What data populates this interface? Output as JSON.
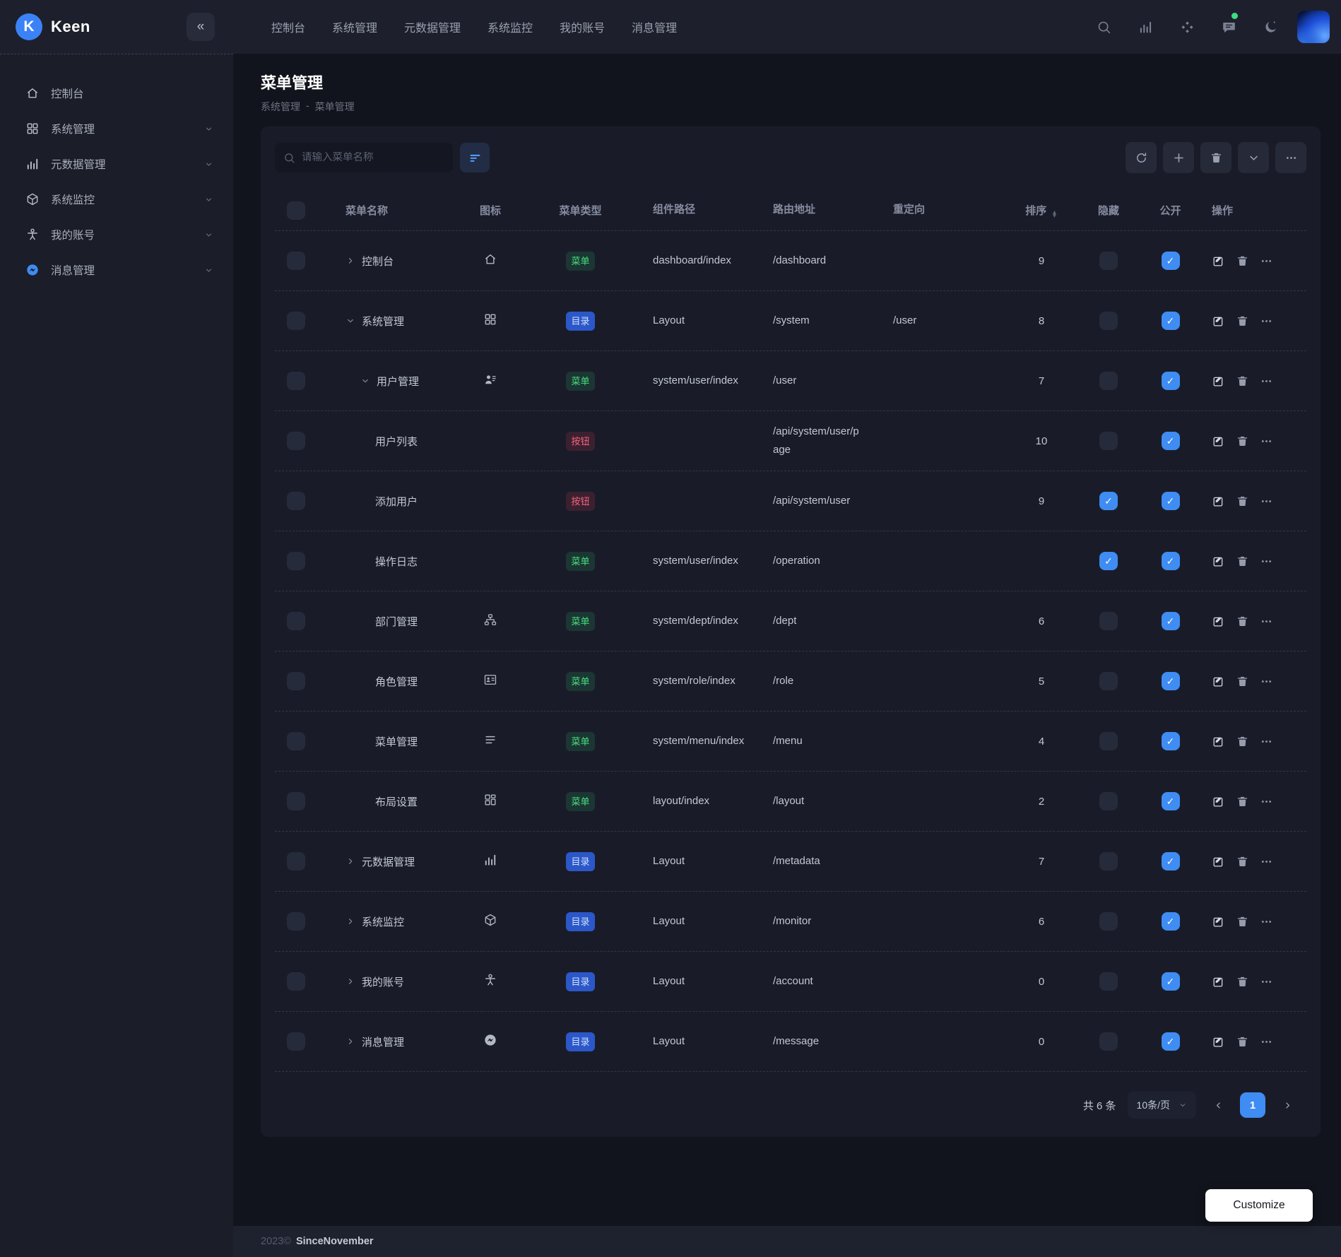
{
  "brand": {
    "name": "Keen"
  },
  "navbar": {
    "collapse_icon": "«",
    "items": [
      "控制台",
      "系统管理",
      "元数据管理",
      "系统监控",
      "我的账号",
      "消息管理"
    ],
    "action_icons": [
      "search",
      "chart",
      "apps",
      "chat",
      "moon"
    ],
    "chat_has_badge": true
  },
  "sidebar": {
    "items": [
      {
        "label": "控制台",
        "icon": "home",
        "expandable": false
      },
      {
        "label": "系统管理",
        "icon": "grid",
        "expandable": true
      },
      {
        "label": "元数据管理",
        "icon": "chart",
        "expandable": true
      },
      {
        "label": "系统监控",
        "icon": "cube",
        "expandable": true
      },
      {
        "label": "我的账号",
        "icon": "person",
        "expandable": true
      },
      {
        "label": "消息管理",
        "icon": "messenger",
        "expandable": true
      }
    ]
  },
  "page": {
    "title": "菜单管理",
    "breadcrumb": {
      "parent": "系统管理",
      "separator": "-",
      "current": "菜单管理"
    }
  },
  "toolbar": {
    "search_placeholder": "请输入菜单名称",
    "action_icons": [
      "refresh",
      "plus",
      "trash",
      "chevron-down",
      "more"
    ]
  },
  "table": {
    "headers": {
      "name": "菜单名称",
      "icon": "图标",
      "type": "菜单类型",
      "component": "组件路径",
      "route": "路由地址",
      "redirect": "重定向",
      "sort": "排序",
      "hidden": "隐藏",
      "public": "公开",
      "ops": "操作"
    },
    "rows": [
      {
        "name": "控制台",
        "level": 0,
        "expand": "closed",
        "icon": "home",
        "type": "menu",
        "type_label": "菜单",
        "component": "dashboard/index",
        "route": "/dashboard",
        "redirect": "",
        "sort": "9",
        "hidden": false,
        "public": true
      },
      {
        "name": "系统管理",
        "level": 0,
        "expand": "open",
        "icon": "grid",
        "type": "dir",
        "type_label": "目录",
        "component": "Layout",
        "route": "/system",
        "redirect": "/user",
        "sort": "8",
        "hidden": false,
        "public": true
      },
      {
        "name": "用户管理",
        "level": 1,
        "expand": "open",
        "icon": "user-list",
        "type": "menu",
        "type_label": "菜单",
        "component": "system/user/index",
        "route": "/user",
        "redirect": "",
        "sort": "7",
        "hidden": false,
        "public": true
      },
      {
        "name": "用户列表",
        "level": 2,
        "expand": "",
        "icon": "",
        "type": "btn",
        "type_label": "按钮",
        "component": "",
        "route": "/api/system/user/page",
        "redirect": "",
        "sort": "10",
        "hidden": false,
        "public": true
      },
      {
        "name": "添加用户",
        "level": 2,
        "expand": "",
        "icon": "",
        "type": "btn",
        "type_label": "按钮",
        "component": "",
        "route": "/api/system/user",
        "redirect": "",
        "sort": "9",
        "hidden": true,
        "public": true
      },
      {
        "name": "操作日志",
        "level": 2,
        "expand": "",
        "icon": "",
        "type": "menu",
        "type_label": "菜单",
        "component": "system/user/index",
        "route": "/operation",
        "redirect": "",
        "sort": "",
        "hidden": true,
        "public": true
      },
      {
        "name": "部门管理",
        "level": 2,
        "expand": "",
        "icon": "org",
        "type": "menu",
        "type_label": "菜单",
        "component": "system/dept/index",
        "route": "/dept",
        "redirect": "",
        "sort": "6",
        "hidden": false,
        "public": true
      },
      {
        "name": "角色管理",
        "level": 2,
        "expand": "",
        "icon": "idcard",
        "type": "menu",
        "type_label": "菜单",
        "component": "system/role/index",
        "route": "/role",
        "redirect": "",
        "sort": "5",
        "hidden": false,
        "public": true
      },
      {
        "name": "菜单管理",
        "level": 2,
        "expand": "",
        "icon": "list",
        "type": "menu",
        "type_label": "菜单",
        "component": "system/menu/index",
        "route": "/menu",
        "redirect": "",
        "sort": "4",
        "hidden": false,
        "public": true
      },
      {
        "name": "布局设置",
        "level": 2,
        "expand": "",
        "icon": "layout",
        "type": "menu",
        "type_label": "菜单",
        "component": "layout/index",
        "route": "/layout",
        "redirect": "",
        "sort": "2",
        "hidden": false,
        "public": true
      },
      {
        "name": "元数据管理",
        "level": 0,
        "expand": "closed",
        "icon": "chart",
        "type": "dir",
        "type_label": "目录",
        "component": "Layout",
        "route": "/metadata",
        "redirect": "",
        "sort": "7",
        "hidden": false,
        "public": true
      },
      {
        "name": "系统监控",
        "level": 0,
        "expand": "closed",
        "icon": "cube",
        "type": "dir",
        "type_label": "目录",
        "component": "Layout",
        "route": "/monitor",
        "redirect": "",
        "sort": "6",
        "hidden": false,
        "public": true
      },
      {
        "name": "我的账号",
        "level": 0,
        "expand": "closed",
        "icon": "person",
        "type": "dir",
        "type_label": "目录",
        "component": "Layout",
        "route": "/account",
        "redirect": "",
        "sort": "0",
        "hidden": false,
        "public": true
      },
      {
        "name": "消息管理",
        "level": 0,
        "expand": "closed",
        "icon": "messenger",
        "type": "dir",
        "type_label": "目录",
        "component": "Layout",
        "route": "/message",
        "redirect": "",
        "sort": "0",
        "hidden": false,
        "public": true
      }
    ]
  },
  "pagination": {
    "total": "共 6 条",
    "page_size": "10条/页",
    "page": "1"
  },
  "footer": {
    "year": "2023©",
    "author": "SinceNovember"
  },
  "customize": {
    "label": "Customize"
  },
  "colors": {
    "accent": "#3f8cf3",
    "menu_badge_text": "#4ade80",
    "dir_badge_bg": "#2b57c8",
    "btn_badge_text": "#f4617e",
    "online_dot": "#3ddc84",
    "navbar_bg": "#1d202c",
    "card_bg": "#191c28"
  }
}
